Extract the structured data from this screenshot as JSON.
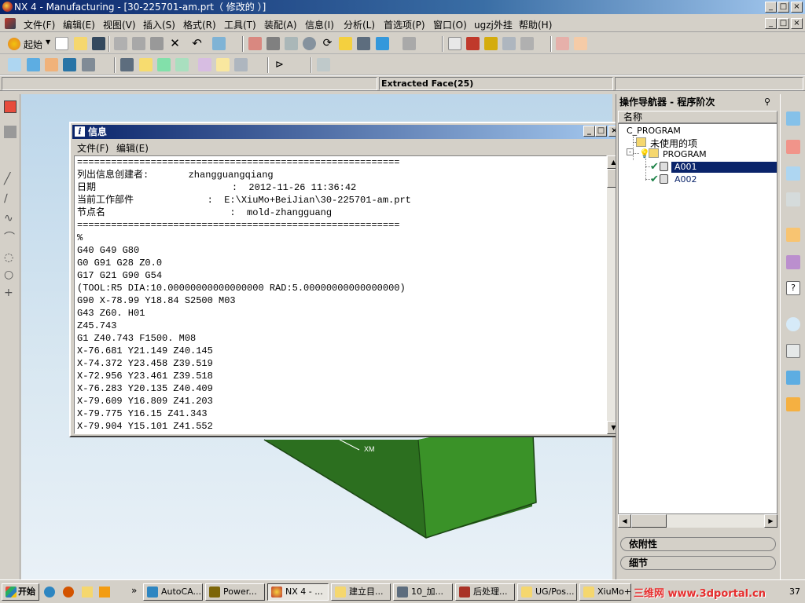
{
  "window": {
    "title": "NX 4 - Manufacturing - [30-225701-am.prt（ 修改的 ）]"
  },
  "menu": [
    "文件(F)",
    "编辑(E)",
    "视图(V)",
    "插入(S)",
    "格式(R)",
    "工具(T)",
    "装配(A)",
    "信息(I)",
    "分析(L)",
    "首选项(P)",
    "窗口(O)",
    "ugzj外挂",
    "帮助(H)"
  ],
  "toolbar": {
    "start_label": "起始"
  },
  "cue": {
    "selection": "Extracted Face(25)"
  },
  "info": {
    "title": "信息",
    "menu": [
      "文件(F)",
      "编辑(E)"
    ],
    "lines": [
      "=========================================================",
      "列出信息创建者:       zhangguangqiang",
      "日期                        :  2012-11-26 11:36:42",
      "当前工作部件             :  E:\\XiuMo+BeiJian\\30-225701-am.prt",
      "节点名                      :  mold-zhangguang",
      "=========================================================",
      "%",
      "G40 G49 G80",
      "G0 G91 G28 Z0.0",
      "G17 G21 G90 G54",
      "(TOOL:R5 DIA:10.00000000000000000 RAD:5.00000000000000000)",
      "G90 X-78.99 Y18.84 S2500 M03",
      "G43 Z60. H01",
      "Z45.743",
      "G1 Z40.743 F1500. M08",
      "X-76.681 Y21.149 Z40.145",
      "X-74.372 Y23.458 Z39.519",
      "X-72.956 Y23.461 Z39.518",
      "X-76.283 Y20.135 Z40.409",
      "X-79.609 Y16.809 Z41.203",
      "X-79.775 Y16.15 Z41.343",
      "X-79.904 Y15.101 Z41.552"
    ]
  },
  "viewport": {
    "axis_label": "XM"
  },
  "navigator": {
    "title": "操作导航器 - 程序阶次",
    "column": "名称",
    "items": [
      {
        "label": "C_PROGRAM"
      },
      {
        "label": "未使用的项"
      },
      {
        "label": "PROGRAM"
      },
      {
        "label": "A001",
        "selected": true
      },
      {
        "label": "A002"
      }
    ],
    "sections": [
      "依附性",
      "细节"
    ]
  },
  "taskbar": {
    "start": "开始",
    "tasks": [
      "AutoCA...",
      "Power...",
      "NX 4 - ...",
      "建立目...",
      "10_加...",
      "后处理...",
      "UG/Pos...",
      "XiuMo+..."
    ],
    "watermark": "三维网 www.3dportal.cn",
    "clock": "37"
  },
  "colors": {
    "titlebar": "#0a246a",
    "selection": "#0a246a",
    "part": "#2f7a22"
  }
}
